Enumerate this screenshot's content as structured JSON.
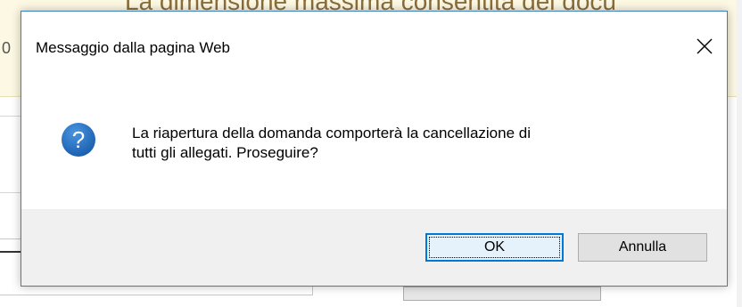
{
  "background": {
    "banner_text": "La dimensione massima consentita dei docu",
    "left_digit": "0"
  },
  "dialog": {
    "title": "Messaggio dalla pagina Web",
    "message_lines": [
      "La riapertura della domanda comporterà la cancellazione di",
      "tutti gli allegati. Proseguire?"
    ],
    "icon": "question-icon",
    "buttons": {
      "ok_label": "OK",
      "cancel_label": "Annulla"
    }
  },
  "colors": {
    "dialog_border": "#3c7fc1",
    "icon_blue": "#1e6fc0",
    "footer_bg": "#f0f0f0",
    "default_button_border": "#0078d7",
    "banner_bg": "#fcf8e3"
  }
}
